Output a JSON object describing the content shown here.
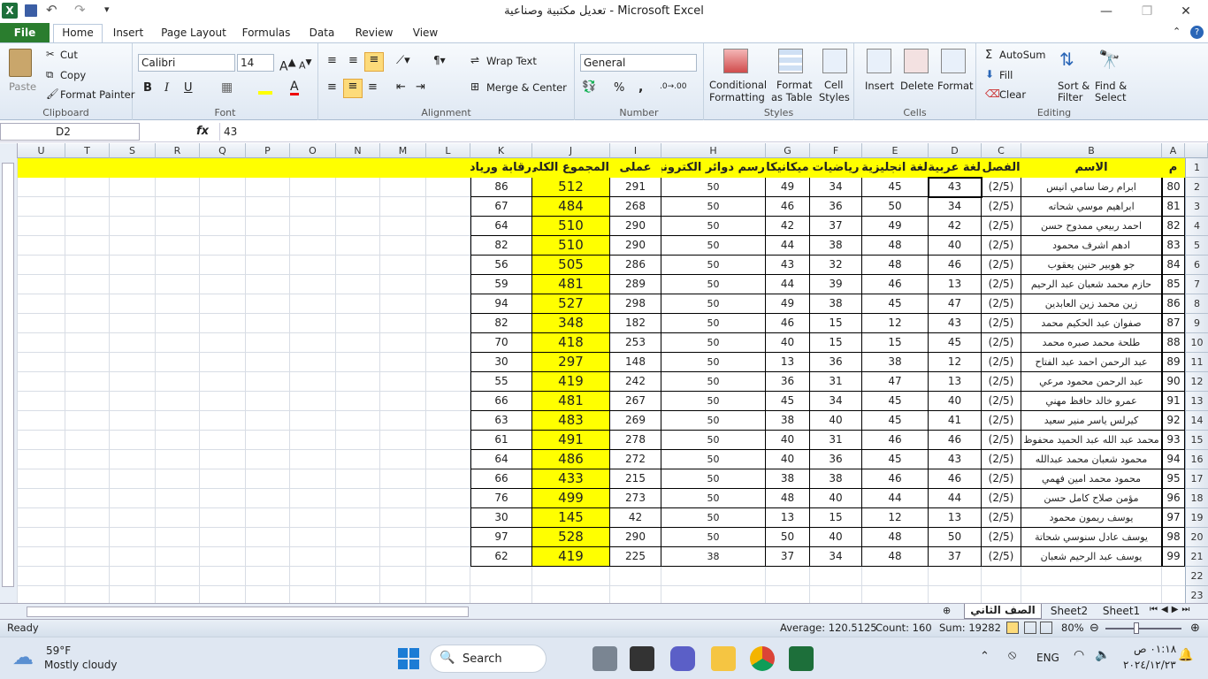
{
  "window": {
    "title": "تعديل مكتبية وصناعية - Microsoft Excel"
  },
  "tabs": [
    "File",
    "Home",
    "Insert",
    "Page Layout",
    "Formulas",
    "Data",
    "Review",
    "View"
  ],
  "clipboard": {
    "paste": "Paste",
    "cut": "Cut",
    "copy": "Copy",
    "format_painter": "Format Painter",
    "label": "Clipboard"
  },
  "font": {
    "name": "Calibri",
    "size": "14",
    "label": "Font"
  },
  "alignment": {
    "wrap": "Wrap Text",
    "merge": "Merge & Center",
    "label": "Alignment"
  },
  "number": {
    "format": "General",
    "label": "Number",
    "percent": "%",
    "comma": ","
  },
  "styles": {
    "conditional": "Conditional",
    "formatting": "Formatting",
    "format_as": "Format",
    "as_table": "as Table",
    "cell": "Cell",
    "cell_styles": "Styles",
    "label": "Styles"
  },
  "cells_group": {
    "insert": "Insert",
    "delete": "Delete",
    "format": "Format",
    "label": "Cells"
  },
  "editing": {
    "autosum": "AutoSum",
    "fill": "Fill",
    "clear": "Clear",
    "sort1": "Sort &",
    "sort2": "Filter",
    "find1": "Find &",
    "find2": "Select",
    "label": "Editing"
  },
  "formula_bar": {
    "name_box": "D2",
    "fx": "fx",
    "value": "43"
  },
  "columns": [
    "A",
    "B",
    "C",
    "D",
    "E",
    "F",
    "G",
    "H",
    "I",
    "J",
    "K",
    "L",
    "M",
    "N",
    "O",
    "P",
    "Q",
    "R",
    "S",
    "T",
    "U"
  ],
  "row_numbers": [
    "1",
    "2",
    "3",
    "4",
    "5",
    "6",
    "7",
    "8",
    "9",
    "10",
    "11",
    "12",
    "13",
    "14",
    "15",
    "16",
    "17",
    "18",
    "19",
    "20",
    "21",
    "22",
    "23"
  ],
  "headers": [
    "م",
    "الاسم",
    "الفصل",
    "لغة عربية",
    "لغة انجليزية",
    "رياضيات",
    "ميكانيكا",
    "رسم دوائر الكترونية",
    "عملى",
    "المجموع الكلى",
    "رقابة وريادة"
  ],
  "rows": [
    [
      "80",
      "ابرام رضا سامي انيس",
      "(2/5)",
      "43",
      "45",
      "34",
      "49",
      "50",
      "291",
      "512",
      "86"
    ],
    [
      "81",
      "ابراهيم موسي شحاته",
      "(2/5)",
      "34",
      "50",
      "36",
      "46",
      "50",
      "268",
      "484",
      "67"
    ],
    [
      "82",
      "احمد ربيعي ممدوح حسن",
      "(2/5)",
      "42",
      "49",
      "37",
      "42",
      "50",
      "290",
      "510",
      "64"
    ],
    [
      "83",
      "ادهم اشرف محمود",
      "(2/5)",
      "40",
      "48",
      "38",
      "44",
      "50",
      "290",
      "510",
      "82"
    ],
    [
      "84",
      "جو هوبير حنين يعقوب",
      "(2/5)",
      "46",
      "48",
      "32",
      "43",
      "50",
      "286",
      "505",
      "56"
    ],
    [
      "85",
      "حازم محمد شعبان عبد الرحيم",
      "(2/5)",
      "13",
      "46",
      "39",
      "44",
      "50",
      "289",
      "481",
      "59"
    ],
    [
      "86",
      "زين محمد زين العابدين",
      "(2/5)",
      "47",
      "45",
      "38",
      "49",
      "50",
      "298",
      "527",
      "94"
    ],
    [
      "87",
      "صفوان عبد الحكيم محمد",
      "(2/5)",
      "43",
      "12",
      "15",
      "46",
      "50",
      "182",
      "348",
      "82"
    ],
    [
      "88",
      "طلحة محمد صبره محمد",
      "(2/5)",
      "45",
      "15",
      "15",
      "40",
      "50",
      "253",
      "418",
      "70"
    ],
    [
      "89",
      "عبد الرحمن احمد عبد الفتاح",
      "(2/5)",
      "12",
      "38",
      "36",
      "13",
      "50",
      "148",
      "297",
      "30"
    ],
    [
      "90",
      "عبد الرحمن محمود مرعي",
      "(2/5)",
      "13",
      "47",
      "31",
      "36",
      "50",
      "242",
      "419",
      "55"
    ],
    [
      "91",
      "عمرو خالد حافظ مهني",
      "(2/5)",
      "40",
      "45",
      "34",
      "45",
      "50",
      "267",
      "481",
      "66"
    ],
    [
      "92",
      "كيرلس ياسر منير سعيد",
      "(2/5)",
      "41",
      "45",
      "40",
      "38",
      "50",
      "269",
      "483",
      "63"
    ],
    [
      "93",
      "محمد عبد الله عبد الحميد محفوظ",
      "(2/5)",
      "46",
      "46",
      "31",
      "40",
      "50",
      "278",
      "491",
      "61"
    ],
    [
      "94",
      "محمود شعبان محمد عبدالله",
      "(2/5)",
      "43",
      "45",
      "36",
      "40",
      "50",
      "272",
      "486",
      "64"
    ],
    [
      "95",
      "محمود محمد امين فهمي",
      "(2/5)",
      "46",
      "46",
      "38",
      "38",
      "50",
      "215",
      "433",
      "66"
    ],
    [
      "96",
      "مؤمن صلاح كامل حسن",
      "(2/5)",
      "44",
      "44",
      "40",
      "48",
      "50",
      "273",
      "499",
      "76"
    ],
    [
      "97",
      "يوسف ريمون محمود",
      "(2/5)",
      "13",
      "12",
      "15",
      "13",
      "50",
      "42",
      "145",
      "30"
    ],
    [
      "98",
      "يوسف عادل سنوسي شحاتة",
      "(2/5)",
      "50",
      "48",
      "40",
      "50",
      "50",
      "290",
      "528",
      "97"
    ],
    [
      "99",
      "يوسف عبد الرحيم شعبان",
      "(2/5)",
      "37",
      "48",
      "34",
      "37",
      "38",
      "225",
      "419",
      "62"
    ]
  ],
  "sheets": [
    "الصف الثاني",
    "Sheet2",
    "Sheet1"
  ],
  "status": {
    "ready": "Ready",
    "average": "Average: 120.5125",
    "count": "Count: 160",
    "sum": "Sum: 19282",
    "zoom": "80%"
  },
  "taskbar": {
    "temp": "59°F",
    "weather": "Mostly cloudy",
    "search": "Search",
    "lang": "ENG",
    "time": "٠١:١٨ ص",
    "date": "٢٠٢٤/١٢/٢٣"
  },
  "colors": {
    "yellow": "#ffff00",
    "file_tab": "#2a7d2e"
  }
}
